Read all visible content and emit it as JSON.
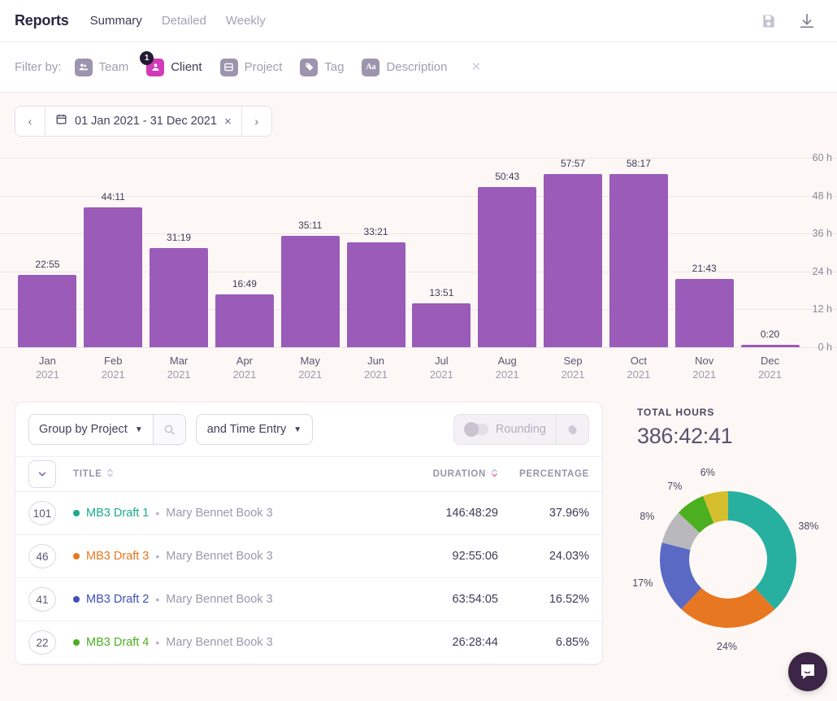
{
  "header": {
    "title": "Reports",
    "tabs": [
      {
        "label": "Summary",
        "active": true
      },
      {
        "label": "Detailed",
        "active": false
      },
      {
        "label": "Weekly",
        "active": false
      }
    ],
    "actions": [
      {
        "name": "save-icon",
        "label": "Save"
      },
      {
        "name": "download-icon",
        "label": "Download"
      }
    ]
  },
  "filters": {
    "label": "Filter by:",
    "items": [
      {
        "label": "Team",
        "icon": "team-icon",
        "active": false,
        "badge": ""
      },
      {
        "label": "Client",
        "icon": "client-icon",
        "active": true,
        "badge": "1"
      },
      {
        "label": "Project",
        "icon": "project-icon",
        "active": false,
        "badge": ""
      },
      {
        "label": "Tag",
        "icon": "tag-icon",
        "active": false,
        "badge": ""
      },
      {
        "label": "Description",
        "icon": "description-icon",
        "active": false,
        "badge": ""
      }
    ],
    "clear_label": "×"
  },
  "date_range": {
    "prev_label": "‹",
    "next_label": "›",
    "text": "01 Jan 2021 - 31 Dec 2021",
    "clear_label": "×"
  },
  "chart_data": {
    "type": "bar",
    "title": "",
    "xlabel": "",
    "ylabel": "",
    "grid": true,
    "ylim": [
      0,
      60
    ],
    "ytick_labels": [
      "60 h",
      "48 h",
      "36 h",
      "24 h",
      "12 h",
      "0 h"
    ],
    "yticks": [
      60,
      48,
      36,
      24,
      12,
      0
    ],
    "categories": [
      "Jan 2021",
      "Feb 2021",
      "Mar 2021",
      "Apr 2021",
      "May 2021",
      "Jun 2021",
      "Jul 2021",
      "Aug 2021",
      "Sep 2021",
      "Oct 2021",
      "Nov 2021",
      "Dec 2021"
    ],
    "months": [
      "Jan",
      "Feb",
      "Mar",
      "Apr",
      "May",
      "Jun",
      "Jul",
      "Aug",
      "Sep",
      "Oct",
      "Nov",
      "Dec"
    ],
    "years": [
      "2021",
      "2021",
      "2021",
      "2021",
      "2021",
      "2021",
      "2021",
      "2021",
      "2021",
      "2021",
      "2021",
      "2021"
    ],
    "value_labels": [
      "22:55",
      "44:11",
      "31:19",
      "16:49",
      "35:11",
      "33:21",
      "13:51",
      "50:43",
      "57:57",
      "58:17",
      "21:43",
      "0:20"
    ],
    "values": [
      22.92,
      44.18,
      31.32,
      16.82,
      35.18,
      33.35,
      13.85,
      50.72,
      57.95,
      58.28,
      21.72,
      0.33
    ],
    "bar_color": "#9a5cb8"
  },
  "table_controls": {
    "group_by": "Group by Project",
    "search_icon": "search-icon",
    "secondary": "and Time Entry",
    "rounding_label": "Rounding",
    "rounding_on": false,
    "gear_icon": "gear-icon"
  },
  "table": {
    "columns": [
      "TITLE",
      "DURATION",
      "PERCENTAGE"
    ],
    "rows": [
      {
        "count": "101",
        "dot": "#1aab8e",
        "project": "MB3 Draft 1",
        "client": "Mary Bennet Book 3",
        "duration": "146:48:29",
        "percentage": "37.96%"
      },
      {
        "count": "46",
        "dot": "#e87722",
        "project": "MB3 Draft 3",
        "client": "Mary Bennet Book 3",
        "duration": "92:55:06",
        "percentage": "24.03%"
      },
      {
        "count": "41",
        "dot": "#3f51b5",
        "project": "MB3 Draft 2",
        "client": "Mary Bennet Book 3",
        "duration": "63:54:05",
        "percentage": "16.52%"
      },
      {
        "count": "22",
        "dot": "#4caf20",
        "project": "MB3 Draft 4",
        "client": "Mary Bennet Book 3",
        "duration": "26:28:44",
        "percentage": "6.85%"
      }
    ],
    "separator": "•"
  },
  "summary": {
    "total_label": "TOTAL HOURS",
    "total_value": "386:42:41",
    "donut": {
      "type": "pie",
      "labels": [
        "38%",
        "24%",
        "17%",
        "8%",
        "7%",
        "6%"
      ],
      "values": [
        38,
        24,
        17,
        8,
        7,
        6
      ],
      "colors": [
        "#27b0a0",
        "#e87722",
        "#5a69c4",
        "#b9b9bd",
        "#4caf20",
        "#d4be2c"
      ]
    }
  },
  "chat": {
    "icon": "chat-bubble-icon"
  }
}
